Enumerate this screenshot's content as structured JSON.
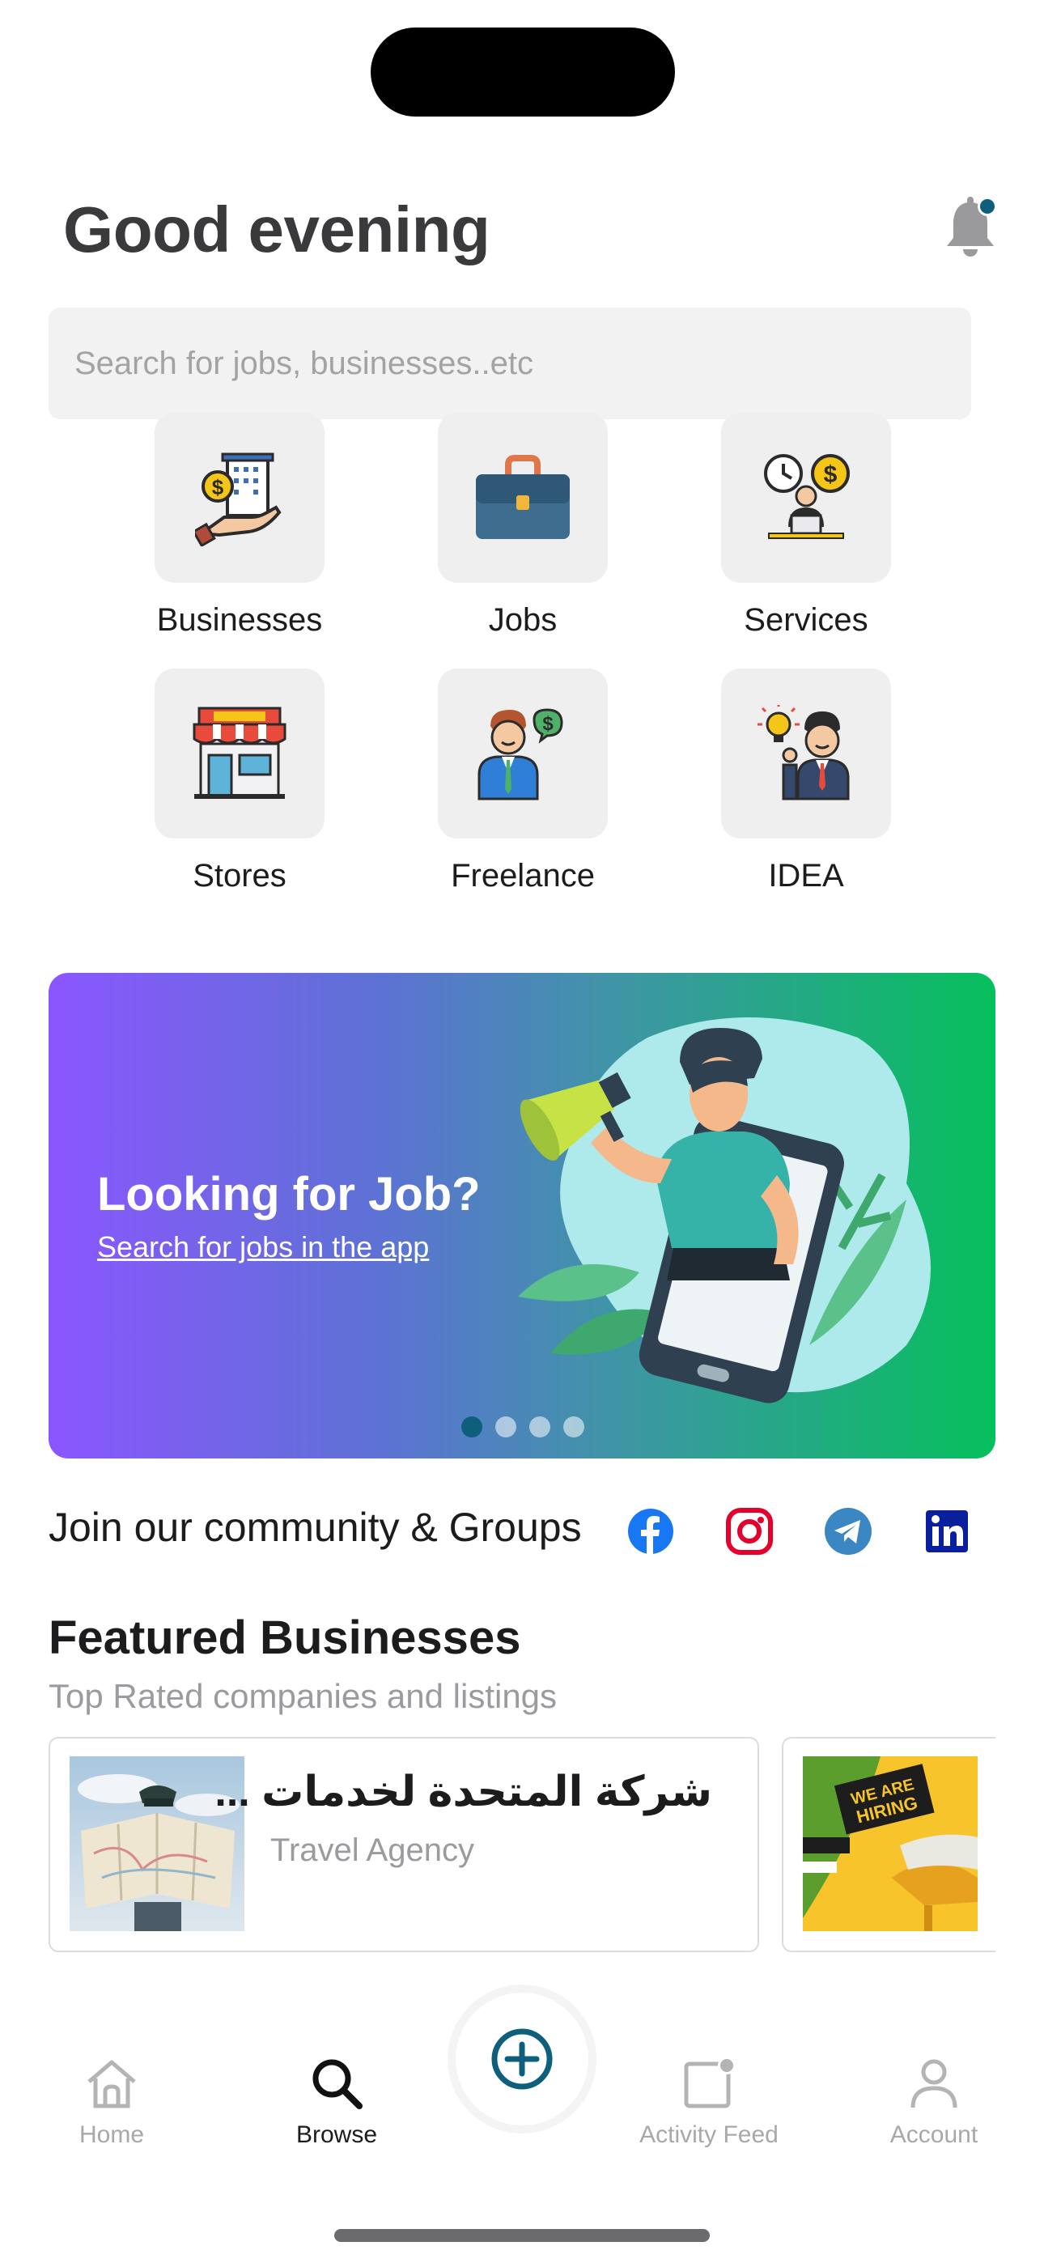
{
  "header": {
    "greeting": "Good evening"
  },
  "search": {
    "placeholder": "Search for jobs, businesses..etc"
  },
  "categories": [
    {
      "label": "Businesses",
      "icon": "business-building-icon"
    },
    {
      "label": "Jobs",
      "icon": "briefcase-icon"
    },
    {
      "label": "Services",
      "icon": "services-clock-money-icon"
    },
    {
      "label": "Stores",
      "icon": "store-icon"
    },
    {
      "label": "Freelance",
      "icon": "freelancer-money-icon"
    },
    {
      "label": "IDEA",
      "icon": "idea-lightbulb-icon"
    }
  ],
  "banner": {
    "title": "Looking for Job?",
    "link": "Search for jobs in the app",
    "slide_count": 4,
    "active_slide": 1
  },
  "community": {
    "label": "Join our community & Groups",
    "links": [
      "facebook-icon",
      "instagram-icon",
      "telegram-icon",
      "linkedin-icon"
    ]
  },
  "featured": {
    "title": "Featured Businesses",
    "subtitle": "Top Rated companies and listings",
    "items": [
      {
        "name": "شركة المتحدة لخدمات ...",
        "type": "Travel Agency"
      },
      {
        "image_text": "WE ARE HIRING"
      }
    ]
  },
  "tabbar": {
    "tabs": [
      {
        "label": "Home",
        "icon": "home-icon"
      },
      {
        "label": "Browse",
        "icon": "search-icon"
      },
      {
        "label": "Activity Feed",
        "icon": "activity-feed-icon"
      },
      {
        "label": "Account",
        "icon": "account-icon"
      }
    ],
    "active": "Browse",
    "fab_icon": "add-circle-icon"
  },
  "colors": {
    "accent": "#0e5f7c",
    "banner_start": "#8b56ff",
    "banner_end": "#06c05c",
    "facebook": "#1877f2",
    "instagram": "#e4002b",
    "telegram": "#3b87c4",
    "linkedin": "#0a1f9c"
  }
}
